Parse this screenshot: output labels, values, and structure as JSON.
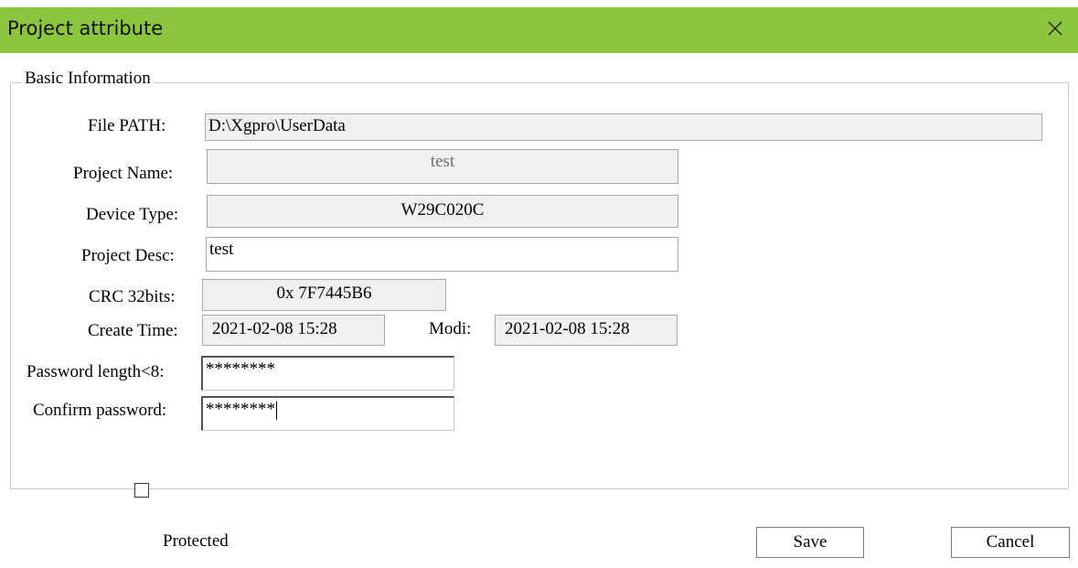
{
  "window": {
    "title": "Project attribute",
    "close_icon": "close-icon"
  },
  "group": {
    "title": "Basic Information"
  },
  "fields": {
    "file_path": {
      "label": "File PATH:",
      "value": "D:\\Xgpro\\UserData"
    },
    "project_name": {
      "label": "Project Name:",
      "value": "test"
    },
    "device_type": {
      "label": "Device Type:",
      "value": "W29C020C"
    },
    "project_desc": {
      "label": "Project Desc:",
      "value": "test"
    },
    "crc": {
      "label": "CRC 32bits:",
      "value": "0x 7F7445B6"
    },
    "create_time": {
      "label": "Create Time:",
      "value": "2021-02-08 15:28"
    },
    "modi_time": {
      "label": "Modi:",
      "value": "2021-02-08 15:28"
    },
    "password": {
      "label": "Password length<8:",
      "value": "********"
    },
    "confirm_password": {
      "label": "Confirm password:",
      "value": "********"
    }
  },
  "protected": {
    "label": "Protected",
    "checked": false
  },
  "buttons": {
    "save": "Save",
    "cancel": "Cancel"
  }
}
